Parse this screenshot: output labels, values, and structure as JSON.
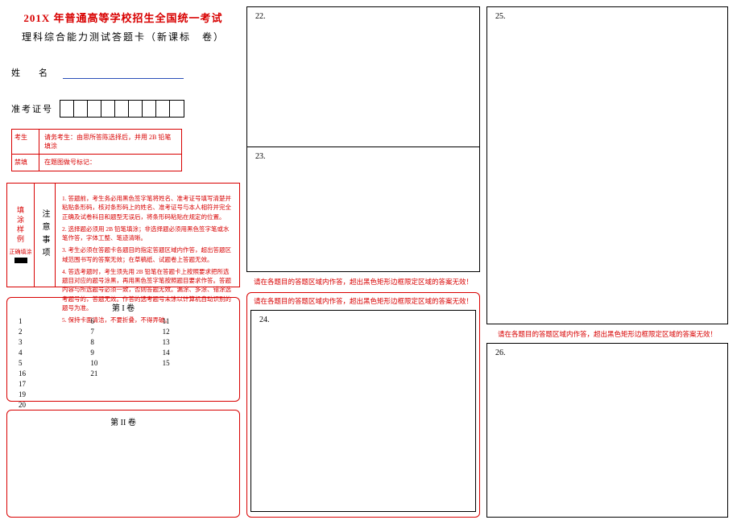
{
  "header": {
    "title_main": "201X 年普通高等学校招生全国统一考试",
    "title_sub": "理科综合能力测试答题卡（新课标　卷）"
  },
  "identity": {
    "name_label": "姓　名",
    "ticket_label": "准考证号",
    "ticket_cells": 9
  },
  "redbox": {
    "row1_left": "考生",
    "row1_right": "请务考生：由思所答陈选择后，并用 2B 铅笔填涂",
    "row2_left": "禁填",
    "row2_right": "在题图做号标记："
  },
  "notes": {
    "left_title": "填涂样例",
    "left_label": "正确填涂",
    "mid_title": "注意事项",
    "items": [
      "1. 答题前，考生务必用黑色签字笔将姓名、准考证号填写清楚并粘贴条形码，核对条形码上的姓名、准考证号与本人相符并完全正确及试卷科目和题型无误后，将条形码粘贴在规定的位置。",
      "2. 选择题必须用 2B 铅笔填涂；非选择题必须用黑色签字笔或水笔作答，字体工整、笔迹清晰。",
      "3. 考生必须在答题卡各题目的指定答题区域内作答，超出答题区域范围书写的答案无效；在草稿纸、试题卷上答题无效。",
      "4. 答选考题时，考生须先用 2B 铅笔在答题卡上按照要求把所选题目对应的题号涂黑，再用黑色签字笔按照题目要求作答。答题内容与所选题号必须一致，否则答题无效。漏涂、多涂、错涂选考题号的，答题无效。作答的选考题号未涂以计算机自动识别的题号为准。",
      "5. 保持卡面清洁，不要折叠，不得弄破。"
    ]
  },
  "section1": {
    "title": "第 I 卷",
    "numbers_col1": [
      "1",
      "2",
      "3",
      "4",
      "5",
      "16",
      "17",
      "19",
      "20"
    ],
    "numbers_col2": [
      "6",
      "7",
      "8",
      "9",
      "10",
      "21",
      "",
      "",
      ""
    ],
    "numbers_col3": [
      "11",
      "12",
      "13",
      "14",
      "15",
      "",
      "",
      "",
      ""
    ]
  },
  "section2": {
    "title": "第 II 卷"
  },
  "answers": {
    "q22": "22.",
    "q23": "23.",
    "q24": "24.",
    "q25": "25.",
    "q26": "26."
  },
  "warnings": {
    "line1": "请在各题目的答题区域内作答，超出黑色矩形边框限定区域的答案无效！",
    "line2": "请在各题目的答题区域内作答，超出黑色矩形边框限定区域的答案无效！",
    "line3": "请在各题目的答题区域内作答，超出黑色矩形边框限定区域的答案无效！"
  }
}
